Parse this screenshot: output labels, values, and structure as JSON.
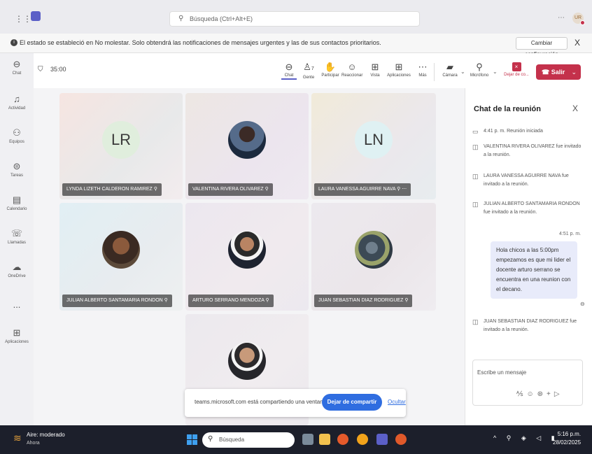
{
  "app": {
    "search_placeholder": "Búsqueda (Ctrl+Alt+E)",
    "more_icon": "ellipsis-icon",
    "user_initials": "UR",
    "brand_color": "#5b5fc7",
    "status_color": "#c4314b"
  },
  "notification": {
    "text": "El estado se estableció en No molestar. Solo obtendrá las notificaciones de mensajes urgentes y las de sus contactos prioritarios.",
    "button_label": "Cambiar configuración",
    "close_label": "X"
  },
  "rail": {
    "items": [
      {
        "label": "Chat",
        "icon": "chat-icon"
      },
      {
        "label": "Actividad",
        "icon": "bell-icon"
      },
      {
        "label": "Equipos",
        "icon": "teams-icon"
      },
      {
        "label": "Tareas",
        "icon": "tasks-icon"
      },
      {
        "label": "Calendario",
        "icon": "calendar-icon"
      },
      {
        "label": "Llamadas",
        "icon": "phone-icon"
      },
      {
        "label": "OneDrive",
        "icon": "cloud-icon"
      },
      {
        "label": "Aplicaciones",
        "icon": "apps-icon"
      }
    ],
    "more_label": "..."
  },
  "meeting": {
    "timer": "35:00",
    "tools": [
      {
        "label": "Chat",
        "icon": "chat-icon"
      },
      {
        "label": "Gente",
        "icon": "people-icon",
        "count": "7"
      },
      {
        "label": "Participar",
        "icon": "raise-hand-icon"
      },
      {
        "label": "Reaccionar",
        "icon": "emoji-icon"
      },
      {
        "label": "Vista",
        "icon": "grid-view-icon"
      },
      {
        "label": "Aplicaciones",
        "icon": "add-app-icon"
      },
      {
        "label": "Más",
        "icon": "more-icon"
      },
      {
        "label": "Cámara",
        "icon": "camera-off-icon"
      },
      {
        "label": "Micrófono",
        "icon": "mic-off-icon"
      },
      {
        "label": "Dejar de co...",
        "icon": "stop-share-icon"
      }
    ],
    "leave_label": "Salir"
  },
  "participants": [
    {
      "name": "LYNDA LIZETH CALDERON RAMIREZ",
      "initials": "LR"
    },
    {
      "name": "VALENTINA RIVERA OLIVAREZ",
      "initials": ""
    },
    {
      "name": "LAURA VANESSA AGUIRRE NAVA",
      "initials": "LN"
    },
    {
      "name": "JULIAN ALBERTO SANTAMARIA RONDON",
      "initials": ""
    },
    {
      "name": "ARTURO SERRANO MENDOZA",
      "initials": ""
    },
    {
      "name": "JUAN SEBASTIAN DIAZ RODRIGUEZ",
      "initials": ""
    },
    {
      "name": "",
      "initials": ""
    }
  ],
  "share_bar": {
    "text": "teams.microsoft.com está compartiendo una ventana.",
    "stop_label": "Dejar de compartir",
    "hide_label": "Ocultar"
  },
  "chat": {
    "title": "Chat de la reunión",
    "close_label": "X",
    "events": [
      "4:41 p. m.   Reunión iniciada",
      "VALENTINA RIVERA OLIVAREZ fue invitado a la reunión.",
      "LAURA VANESSA AGUIRRE NAVA fue invitado a la reunión.",
      "JULIAN ALBERTO SANTAMARIA RONDON fue invitado a la reunión."
    ],
    "message_time": "4:51 p. m.",
    "message_text": "Hola chicos  a las 5:00pm empezamos es que mi lider el docente arturo serrano se encuentra en una reunion con el decano.",
    "event_after": "JUAN SEBASTIAN DIAZ RODRIGUEZ fue invitado a la reunión.",
    "compose_placeholder": "Escribe un mensaje"
  },
  "taskbar": {
    "weather_title": "Aire: moderado",
    "weather_sub": "Ahora",
    "search_placeholder": "Búsqueda",
    "time": "5:16 p.m.",
    "date": "28/02/2025"
  }
}
